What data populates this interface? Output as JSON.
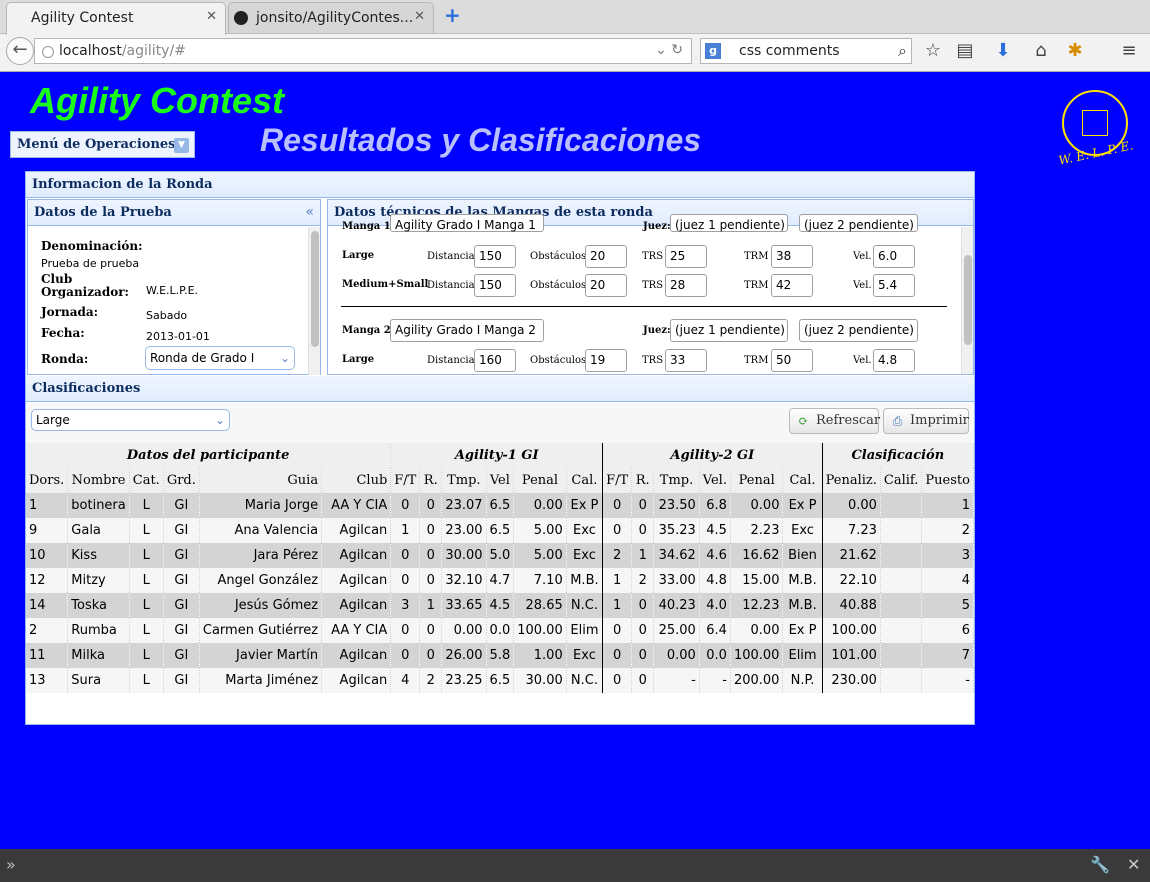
{
  "browser": {
    "tabs": [
      {
        "label": "Agility Contest"
      },
      {
        "label": "jonsito/AgilityContes..."
      }
    ],
    "url_host": "localhost",
    "url_path": "/agility/#",
    "search_value": "css comments"
  },
  "header": {
    "app_title": "Agility Contest",
    "subtitle": "Resultados y Clasificaciones",
    "menu_label": "Menú de Operaciones",
    "logo_text": "W. E. L. P. E."
  },
  "round_panel": {
    "title": "Informacion de la Ronda",
    "event": {
      "title": "Datos de la Prueba",
      "denominacion_label": "Denominación:",
      "denominacion_value": "Prueba de prueba",
      "club_label": "Club Organizador:",
      "club_value": "W.E.L.P.E.",
      "jornada_label": "Jornada:",
      "jornada_value": "Sabado",
      "fecha_label": "Fecha:",
      "fecha_value": "2013-01-01",
      "ronda_label": "Ronda:",
      "ronda_value": "Ronda de Grado I"
    },
    "tech": {
      "title": "Datos técnicos de las Mangas de esta ronda",
      "manga1_label": "Manga 1:",
      "manga1_value": "Agility Grado I Manga 1",
      "manga1_juez_label": "Juez:",
      "manga1_juez1": "(juez 1 pendiente)",
      "manga1_juez2": "(juez 2 pendiente)",
      "rows1": [
        {
          "cat": "Large",
          "dist_label": "Distancia",
          "dist": "150",
          "obs_label": "Obstáculos",
          "obs": "20",
          "trs_label": "TRS",
          "trs": "25",
          "trm_label": "TRM",
          "trm": "38",
          "vel_label": "Vel.",
          "vel": "6.0"
        },
        {
          "cat": "Medium+Small",
          "dist_label": "Distancia",
          "dist": "150",
          "obs_label": "Obstáculos",
          "obs": "20",
          "trs_label": "TRS",
          "trs": "28",
          "trm_label": "TRM",
          "trm": "42",
          "vel_label": "Vel.",
          "vel": "5.4"
        }
      ],
      "manga2_label": "Manga 2:",
      "manga2_value": "Agility Grado I Manga 2",
      "manga2_juez_label": "Juez:",
      "manga2_juez1": "(juez 1 pendiente)",
      "manga2_juez2": "(juez 2 pendiente)",
      "rows2": [
        {
          "cat": "Large",
          "dist_label": "Distancia",
          "dist": "160",
          "obs_label": "Obstáculos",
          "obs": "19",
          "trs_label": "TRS",
          "trs": "33",
          "trm_label": "TRM",
          "trm": "50",
          "vel_label": "Vel.",
          "vel": "4.8"
        }
      ]
    }
  },
  "classification": {
    "title": "Clasificaciones",
    "category_value": "Large",
    "refresh_label": "Refrescar",
    "print_label": "Imprimir",
    "groups": [
      "Datos del participante",
      "Agility-1 GI",
      "Agility-2 GI",
      "Clasificación"
    ],
    "columns": [
      "Dors.",
      "Nombre",
      "Cat.",
      "Grd.",
      "Guia",
      "Club",
      "F/T",
      "R.",
      "Tmp.",
      "Vel",
      "Penal",
      "Cal.",
      "F/T",
      "R.",
      "Tmp.",
      "Vel.",
      "Penal",
      "Cal.",
      "Penaliz.",
      "Calif.",
      "Puesto"
    ],
    "rows": [
      [
        "1",
        "botinera",
        "L",
        "GI",
        "Maria Jorge",
        "AA Y CIA",
        "0",
        "0",
        "23.07",
        "6.5",
        "0.00",
        "Ex P",
        "0",
        "0",
        "23.50",
        "6.8",
        "0.00",
        "Ex P",
        "0.00",
        "",
        "1"
      ],
      [
        "9",
        "Gala",
        "L",
        "GI",
        "Ana Valencia",
        "Agilcan",
        "1",
        "0",
        "23.00",
        "6.5",
        "5.00",
        "Exc",
        "0",
        "0",
        "35.23",
        "4.5",
        "2.23",
        "Exc",
        "7.23",
        "",
        "2"
      ],
      [
        "10",
        "Kiss",
        "L",
        "GI",
        "Jara Pérez",
        "Agilcan",
        "0",
        "0",
        "30.00",
        "5.0",
        "5.00",
        "Exc",
        "2",
        "1",
        "34.62",
        "4.6",
        "16.62",
        "Bien",
        "21.62",
        "",
        "3"
      ],
      [
        "12",
        "Mitzy",
        "L",
        "GI",
        "Angel González",
        "Agilcan",
        "0",
        "0",
        "32.10",
        "4.7",
        "7.10",
        "M.B.",
        "1",
        "2",
        "33.00",
        "4.8",
        "15.00",
        "M.B.",
        "22.10",
        "",
        "4"
      ],
      [
        "14",
        "Toska",
        "L",
        "GI",
        "Jesús Gómez",
        "Agilcan",
        "3",
        "1",
        "33.65",
        "4.5",
        "28.65",
        "N.C.",
        "1",
        "0",
        "40.23",
        "4.0",
        "12.23",
        "M.B.",
        "40.88",
        "",
        "5"
      ],
      [
        "2",
        "Rumba",
        "L",
        "GI",
        "Carmen Gutiérrez",
        "AA Y CIA",
        "0",
        "0",
        "0.00",
        "0.0",
        "100.00",
        "Elim",
        "0",
        "0",
        "25.00",
        "6.4",
        "0.00",
        "Ex P",
        "100.00",
        "",
        "6"
      ],
      [
        "11",
        "Milka",
        "L",
        "GI",
        "Javier Martín",
        "Agilcan",
        "0",
        "0",
        "26.00",
        "5.8",
        "1.00",
        "Exc",
        "0",
        "0",
        "0.00",
        "0.0",
        "100.00",
        "Elim",
        "101.00",
        "",
        "7"
      ],
      [
        "13",
        "Sura",
        "L",
        "GI",
        "Marta Jiménez",
        "Agilcan",
        "4",
        "2",
        "23.25",
        "6.5",
        "30.00",
        "N.C.",
        "0",
        "0",
        "-",
        "-",
        "200.00",
        "N.P.",
        "230.00",
        "",
        "-"
      ]
    ]
  }
}
